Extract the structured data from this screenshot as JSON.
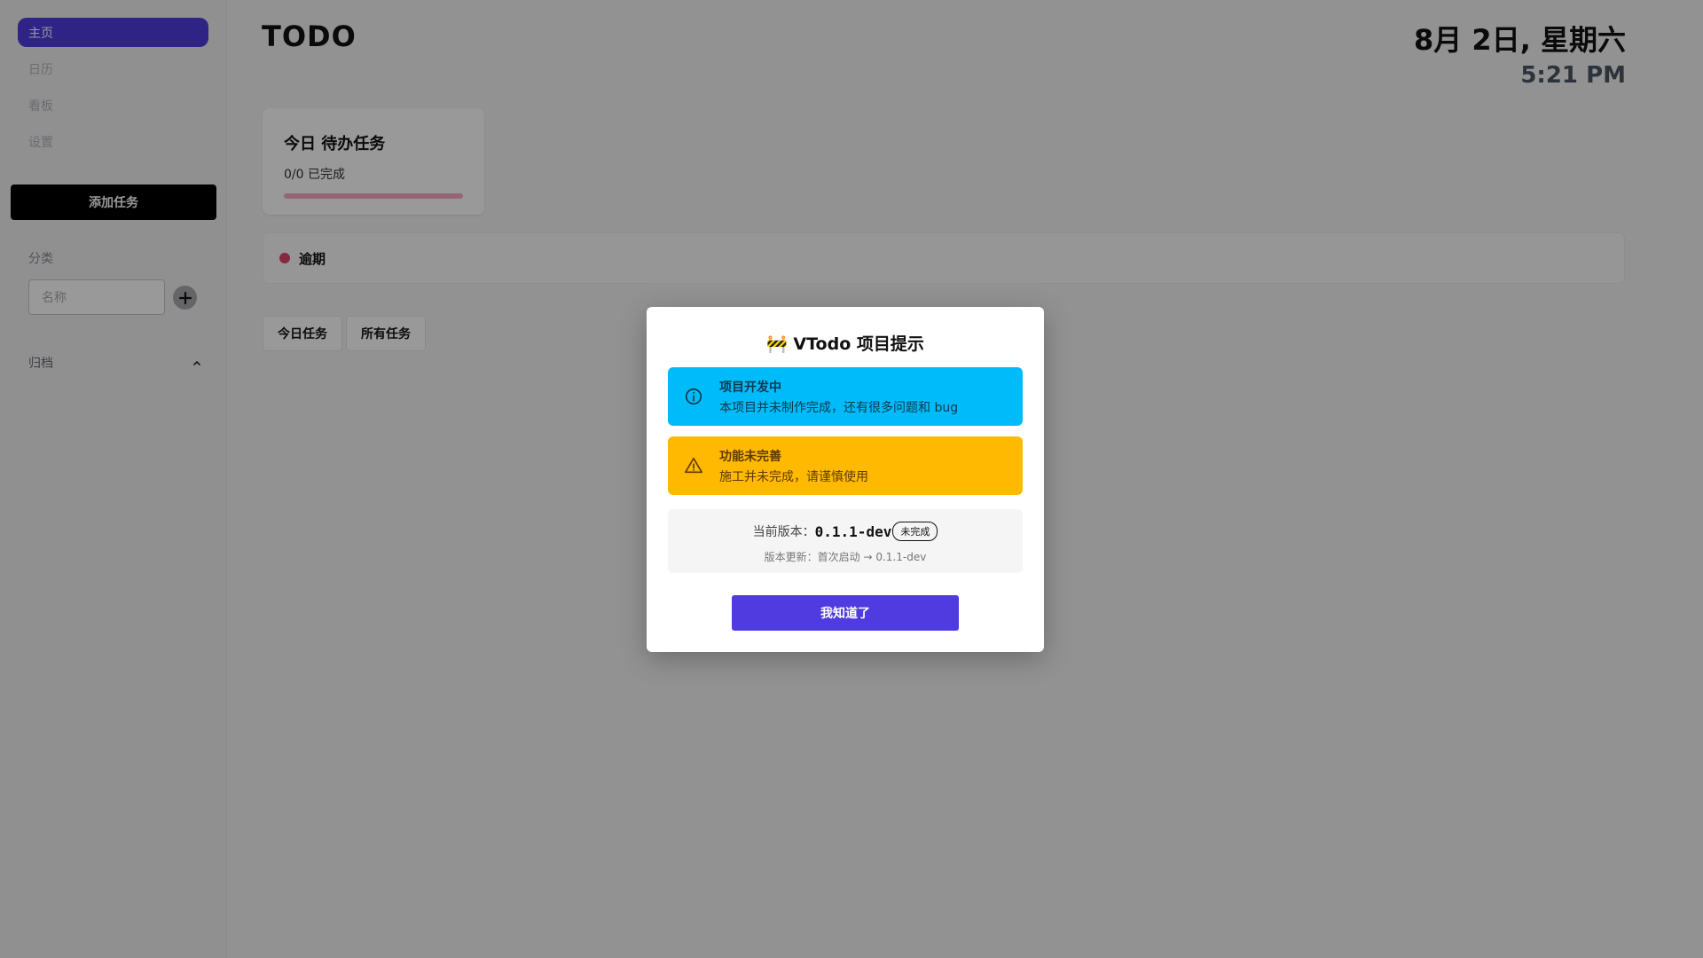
{
  "sidebar": {
    "nav": [
      "主页",
      "日历",
      "看板",
      "设置"
    ],
    "add_task": "添加任务",
    "category_label": "分类",
    "category_placeholder": "名称",
    "archive": "归档"
  },
  "header": {
    "title": "TODO",
    "date": "8月 2日, 星期六",
    "time": "5:21 PM"
  },
  "today": {
    "title": "今日 待办任务",
    "count": "0/0 已完成"
  },
  "overdue": {
    "label": "逾期"
  },
  "tabs": [
    "今日任务",
    "所有任务"
  ],
  "modal": {
    "title": "🚧 VTodo 项目提示",
    "info": {
      "title": "项目开发中",
      "message": "本项目并未制作完成，还有很多问题和 bug"
    },
    "warn": {
      "title": "功能未完善",
      "message": "施工并未完成，请谨慎使用"
    },
    "version_label": "当前版本：",
    "version": "0.1.1-dev",
    "version_badge": "未完成",
    "version_update": "版本更新：首次启动 → 0.1.1-dev",
    "ok_button": "我知道了"
  },
  "colors": {
    "accent": "#4f3bdf",
    "info": "#00bbf9",
    "warn": "#ffb900",
    "overdue": "#e0446a"
  },
  "icons": [
    "plus-icon",
    "chevron-up-icon",
    "info-icon",
    "warning-icon"
  ]
}
